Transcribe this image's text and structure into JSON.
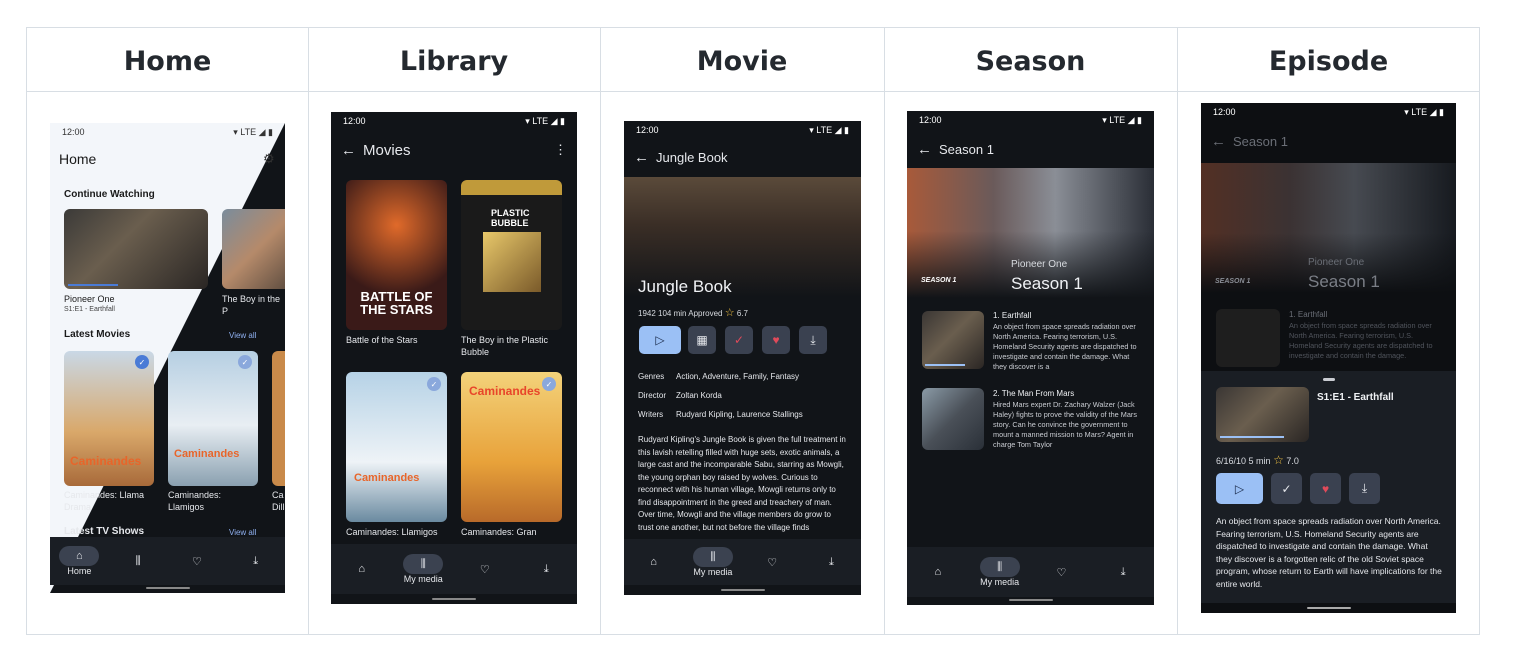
{
  "headers": [
    "Home",
    "Library",
    "Movie",
    "Season",
    "Episode"
  ],
  "status": {
    "time": "12:00",
    "network": "▾ LTE ◢ ▮"
  },
  "home": {
    "title": "Home",
    "continue_title": "Continue Watching",
    "cw_items": [
      {
        "title": "Pioneer One",
        "sub": "S1:E1 - Earthfall"
      },
      {
        "title": "The Boy in the P",
        "sub": ""
      }
    ],
    "latest_movies": "Latest Movies",
    "view_all": "View all",
    "movies": [
      {
        "title": "Caminandes: Llama Drama"
      },
      {
        "title": "Caminandes: Llamigos"
      },
      {
        "title": "Ca Dill"
      }
    ],
    "latest_tv": "Latest TV Shows",
    "view_all2": "View all",
    "nav_home": "Home"
  },
  "library": {
    "title": "Movies",
    "items": [
      {
        "title": "Battle of the Stars"
      },
      {
        "title": "The Boy in the Plastic Bubble"
      },
      {
        "title": "Caminandes: Llamigos"
      },
      {
        "title": "Caminandes: Gran Dillama"
      }
    ],
    "poster_text": [
      "BATTLE OF THE STARS",
      "PLASTIC BUBBLE",
      "Caminandes",
      "Caminandes"
    ],
    "nav_label": "My media"
  },
  "movie": {
    "appbar": "Jungle Book",
    "title": "Jungle Book",
    "meta": "1942  104 min  Approved",
    "rating": "6.7",
    "genres_label": "Genres",
    "genres": "Action, Adventure, Family, Fantasy",
    "director_label": "Director",
    "director": "Zoltan Korda",
    "writers_label": "Writers",
    "writers": "Rudyard Kipling, Laurence Stallings",
    "overview": "Rudyard Kipling's Jungle Book is given the full treatment in this lavish retelling filled with huge sets, exotic animals, a large cast and the incomparable Sabu, starring as Mowgli, the young orphan boy raised by wolves. Curious to reconnect with his human village, Mowgli returns only to find disappointment in the greed and treachery of man. Over time, Mowgli and the village members do grow to trust one another, but not before the village finds",
    "nav_label": "My media"
  },
  "season": {
    "appbar": "Season 1",
    "show": "Pioneer One",
    "season": "Season 1",
    "badge": "SEASON 1",
    "episodes": [
      {
        "title": "1. Earthfall",
        "desc": "An object from space spreads radiation over North America. Fearing terrorism, U.S. Homeland Security agents are dispatched to investigate and contain the damage. What they discover is a"
      },
      {
        "title": "2. The Man From Mars",
        "desc": "Hired Mars expert Dr. Zachary Walzer (Jack Haley) fights to prove the validity of the Mars story. Can he convince the government to mount a manned mission to Mars? Agent in charge Tom Taylor"
      }
    ],
    "nav_label": "My media"
  },
  "episode": {
    "appbar": "Season 1",
    "show": "Pioneer One",
    "season": "Season 1",
    "badge": "SEASON 1",
    "bg_ep_title": "1. Earthfall",
    "bg_ep_desc": "An object from space spreads radiation over North America. Fearing terrorism, U.S. Homeland Security agents are dispatched to investigate and contain the damage.",
    "sheet_title": "S1:E1 - Earthfall",
    "meta": "6/16/10  5 min",
    "rating": "7.0",
    "overview": "An object from space spreads radiation over North America. Fearing terrorism, U.S. Homeland Security agents are dispatched to investigate and contain the damage. What they discover is a forgotten relic of the old Soviet space program, whose return to Earth will have implications for the entire world."
  },
  "colors": {
    "dark_bg": "#111418",
    "accent": "#4a7bd6",
    "play": "#9bc0f5",
    "heart": "#e04a5a"
  }
}
